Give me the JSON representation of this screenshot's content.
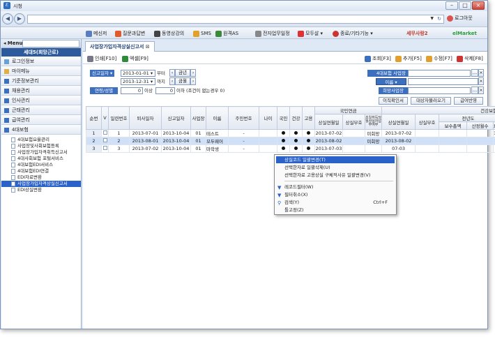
{
  "window": {
    "title": "시청",
    "app_icon": "ℰ"
  },
  "address": {
    "logout": "로그아웃"
  },
  "toolbar": {
    "items": [
      "메신저",
      "질문과답변",
      "동영상강의",
      "SMS",
      "원격AS",
      "전자업무일정",
      "모두살",
      "종료/기타기능"
    ],
    "brand1": "세무사랑2",
    "brand2": "elMarket"
  },
  "sidebar": {
    "menu_label": "Menu",
    "company": "세대5(희망근로)",
    "groups": [
      "로그인정보",
      "마이메뉴",
      "기준정보관리",
      "채용관리",
      "인사관리",
      "근태관리",
      "급여관리",
      "4대보험"
    ],
    "items": [
      "4대보험요율관리",
      "사업장및사회보험등록",
      "사업장가입자격취득신고서",
      "4대사회보험 포털서비스",
      "4대보험EDI서비스",
      "4대보험EDI연결",
      "EDI자료변환",
      "사업장가입자격상실신고서",
      "EDI상실변환"
    ],
    "selected_item": "사업장가입자격상실신고서"
  },
  "main": {
    "tab": "사업장가입자격상실신고서",
    "actions": {
      "print": "인쇄[F10]",
      "excel": "엑셀[F9]",
      "search": "조회[F3]",
      "add": "추가[F5]",
      "edit": "수정[F7]",
      "delete": "삭제[F8]"
    },
    "filters": {
      "period_label": "신고일자",
      "date_from": "2013-01-01",
      "from_suffix": "부터",
      "date_to": "2013-12-31",
      "to_suffix": "까지",
      "prev_month": "금년",
      "this_month": "금월",
      "age_label": "연령/성별",
      "age_from": "0",
      "age_text1": "이상",
      "age_to": "0",
      "age_text2": "이하 (조건이 없는경우 0)",
      "ins_label": "4대보험 사업장",
      "name_label": "이름",
      "hope_label": "희망사업장",
      "btn_confirm": "이직확인서",
      "btn_fetch": "대상자불러오기",
      "btn_apply": "급여반영"
    },
    "grid": {
      "headers": [
        "순번",
        "V",
        "일련번호",
        "퇴사일자",
        "신고일자",
        "사업장",
        "이름",
        "주민번호",
        "나이",
        "국민",
        "건강",
        "고용"
      ],
      "group1": "국민연금",
      "group2": "건강보험",
      "sub_headers": [
        "상실연월일",
        "상실부호",
        "초일취득당월상실자납부여부",
        "상실연월일",
        "상실부호"
      ],
      "sub2": "전년도",
      "sub3": [
        "보수총액",
        "산정월수",
        "보"
      ],
      "rows": [
        {
          "no": "1",
          "serial": "1",
          "retire": "2013-07-01",
          "report": "2013-10-04",
          "site": "01",
          "name": "테스트",
          "rrn": "-",
          "d1": "2013-07-02",
          "p1": "미회망",
          "d2": "2013-07-02",
          "extra": "1,"
        },
        {
          "no": "2",
          "serial": "2",
          "retire": "2013-08-01",
          "report": "2013-10-04",
          "site": "01",
          "name": "모두웨어",
          "rrn": "-",
          "d1": "2013-08-02",
          "p1": "미회망",
          "d2": "2013-08-02",
          "extra": ""
        },
        {
          "no": "3",
          "serial": "3",
          "retire": "2013-07-02",
          "report": "2013-10-04",
          "site": "01",
          "name": "마학생",
          "rrn": "-",
          "d1": "2013-07-03",
          "p1": "",
          "d2": "07-03",
          "extra": ""
        }
      ]
    }
  },
  "context_menu": {
    "items": [
      "상실코드 일괄변경(T)",
      "선택한자료 일괄삭제(U)",
      "선택한자료 고용상실 구체적사유 일괄변경(V)",
      "레코드필터(W)",
      "필터취소(X)",
      "검색(Y)",
      "틀고정(Z)"
    ],
    "shortcut": "Ctrl+F"
  }
}
